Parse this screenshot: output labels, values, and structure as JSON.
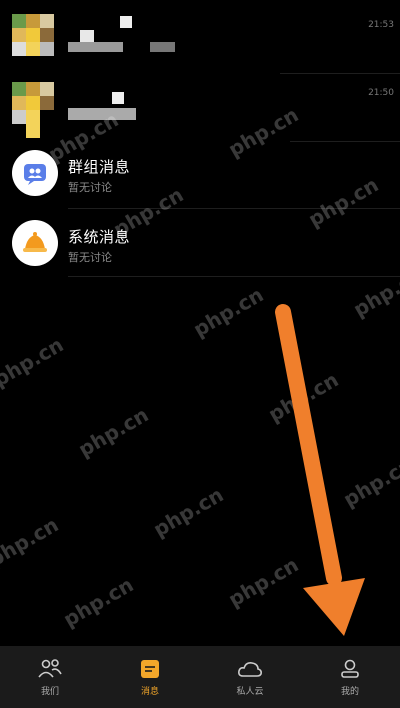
{
  "chats": [
    {
      "time": "21:53"
    },
    {
      "time": "21:50"
    }
  ],
  "group_messages": {
    "title": "群组消息",
    "subtitle": "暂无讨论"
  },
  "system_messages": {
    "title": "系统消息",
    "subtitle": "暂无讨论"
  },
  "watermark_text": "php.cn",
  "tabs": [
    {
      "label": "我们",
      "icon": "people-icon"
    },
    {
      "label": "消息",
      "icon": "message-icon"
    },
    {
      "label": "私人云",
      "icon": "cloud-icon"
    },
    {
      "label": "我的",
      "icon": "profile-icon"
    }
  ],
  "colors": {
    "accent": "#f2a62a",
    "arrow": "#f07f2c",
    "background": "#000000",
    "tabbar": "#1b1b1b"
  }
}
